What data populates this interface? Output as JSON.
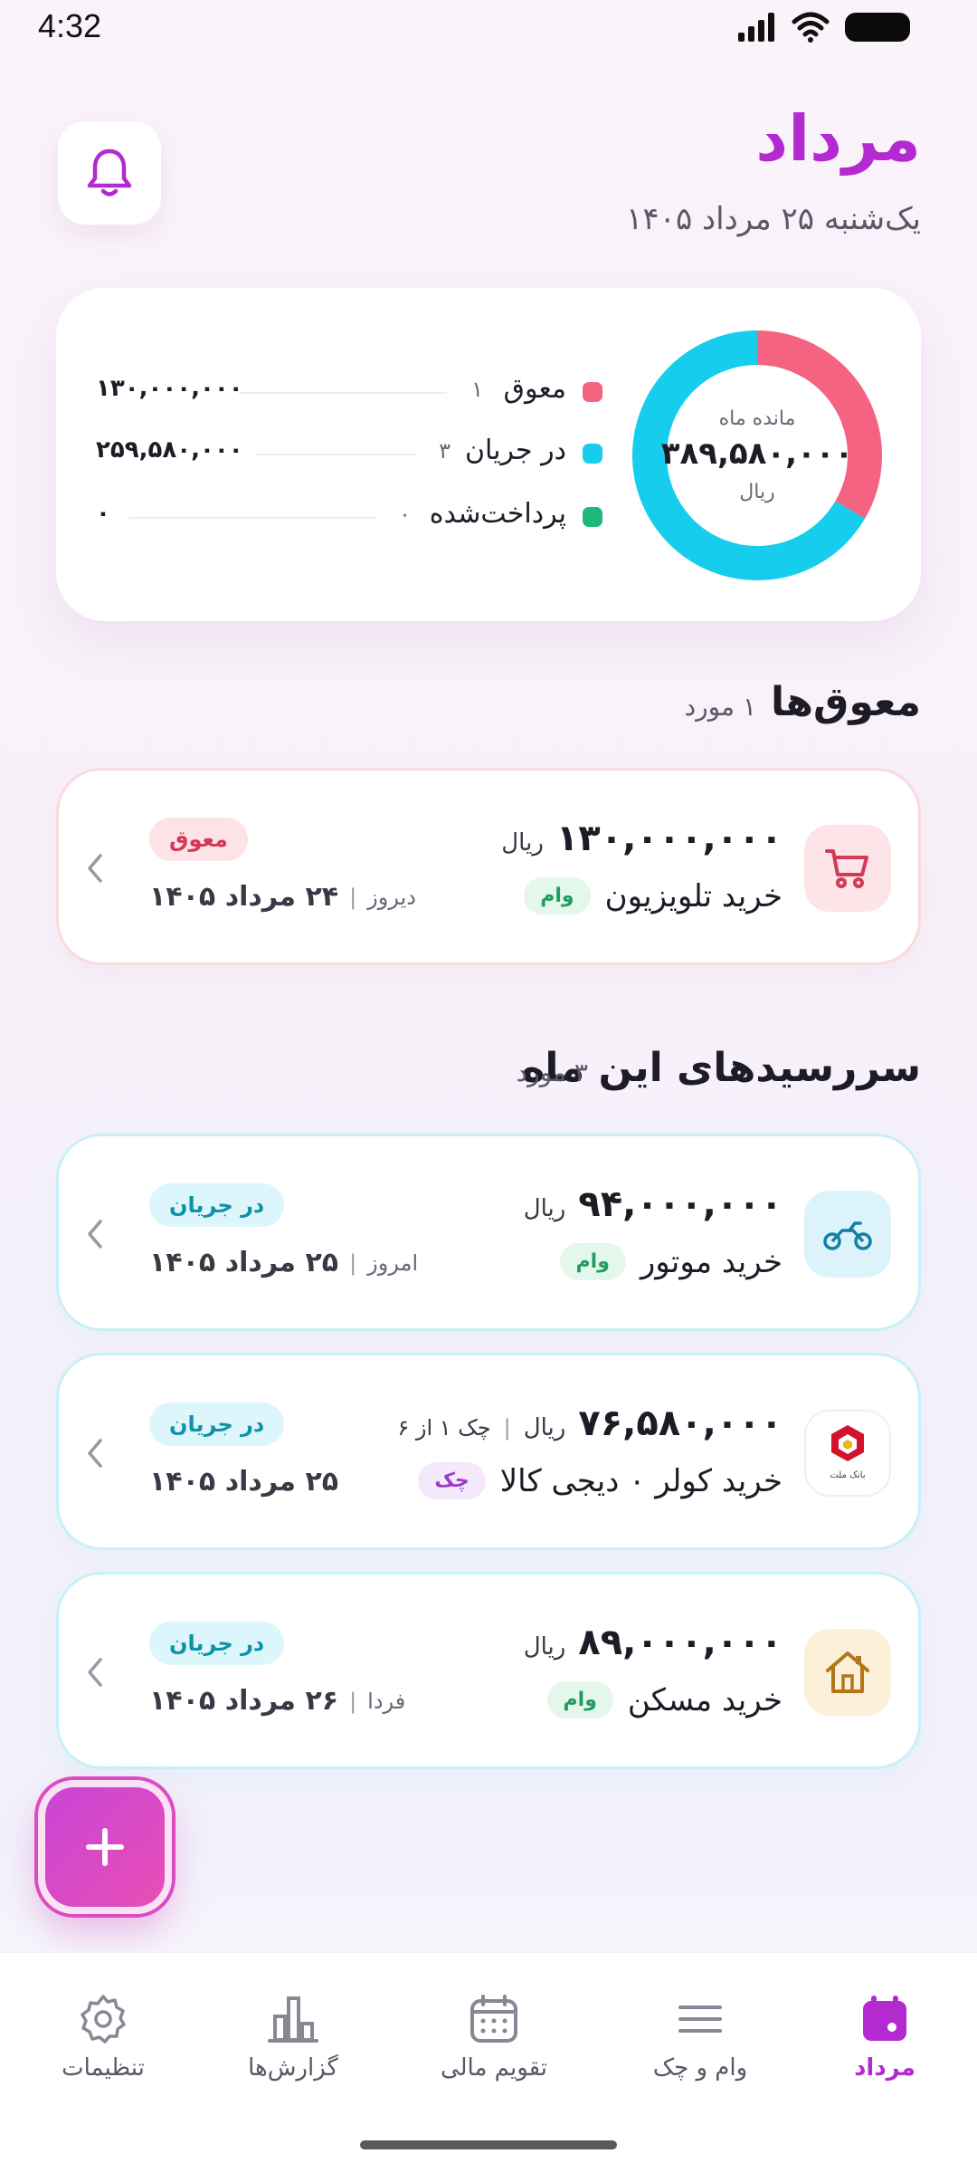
{
  "status_bar": {
    "time": "4:32"
  },
  "header": {
    "title": "مرداد",
    "date": "یک‌شنبه ۲۵ مرداد ۱۴۰۵"
  },
  "summary": {
    "donut_label": "مانده ماه",
    "donut_value": "۳۸۹,۵۸۰,۰۰۰",
    "donut_unit": "ریال",
    "legend": [
      {
        "label": "معوق",
        "count": "۱",
        "amount": "۱۳۰,۰۰۰,۰۰۰",
        "color": "#f4637f",
        "fraction": 0.334
      },
      {
        "label": "در جریان",
        "count": "۳",
        "amount": "۲۵۹,۵۸۰,۰۰۰",
        "color": "#17cdee",
        "fraction": 0.666
      },
      {
        "label": "پرداخت‌شده",
        "count": "۰",
        "amount": "۰",
        "color": "#1fb87a",
        "fraction": 0
      }
    ]
  },
  "overdue_section": {
    "title": "معوق‌ها",
    "count": "۱ مورد"
  },
  "month_section": {
    "title": "سررسیدهای این ماه",
    "count": "۳ مورد"
  },
  "overdue_items": [
    {
      "amount": "۱۳۰,۰۰۰,۰۰۰",
      "unit": "ریال",
      "name": "خرید تلویزیون",
      "tag": "وام",
      "status": "معوق",
      "date": "۲۴ مرداد ۱۴۰۵",
      "relative": "دیروز",
      "icon": "cart-icon"
    }
  ],
  "month_items": [
    {
      "amount": "۹۴,۰۰۰,۰۰۰",
      "unit": "ریال",
      "sub": "",
      "name": "خرید موتور",
      "tag": "وام",
      "status": "در جریان",
      "date": "۲۵ مرداد ۱۴۰۵",
      "relative": "امروز",
      "icon": "motorcycle-icon"
    },
    {
      "amount": "۷۶,۵۸۰,۰۰۰",
      "unit": "ریال",
      "sub": "چک ۱ از ۶",
      "name": "خرید کولر ۰ دیجی کالا",
      "tag": "چک",
      "status": "در جریان",
      "date": "۲۵ مرداد ۱۴۰۵",
      "relative": "",
      "icon": "bank-mellat-logo"
    },
    {
      "amount": "۸۹,۰۰۰,۰۰۰",
      "unit": "ریال",
      "sub": "",
      "name": "خرید مسکن",
      "tag": "وام",
      "status": "در جریان",
      "date": "۲۶ مرداد ۱۴۰۵",
      "relative": "فردا",
      "icon": "house-icon"
    }
  ],
  "bank_logo_text": "بانک ملت",
  "fab": {
    "icon": "plus-icon"
  },
  "nav": [
    {
      "label": "مرداد",
      "icon": "calendar-filled-icon",
      "active": true
    },
    {
      "label": "وام و چک",
      "icon": "menu-lines-icon",
      "active": false
    },
    {
      "label": "تقویم مالی",
      "icon": "calendar-icon",
      "active": false
    },
    {
      "label": "گزارش‌ها",
      "icon": "bar-chart-icon",
      "active": false
    },
    {
      "label": "تنظیمات",
      "icon": "gear-icon",
      "active": false
    }
  ]
}
